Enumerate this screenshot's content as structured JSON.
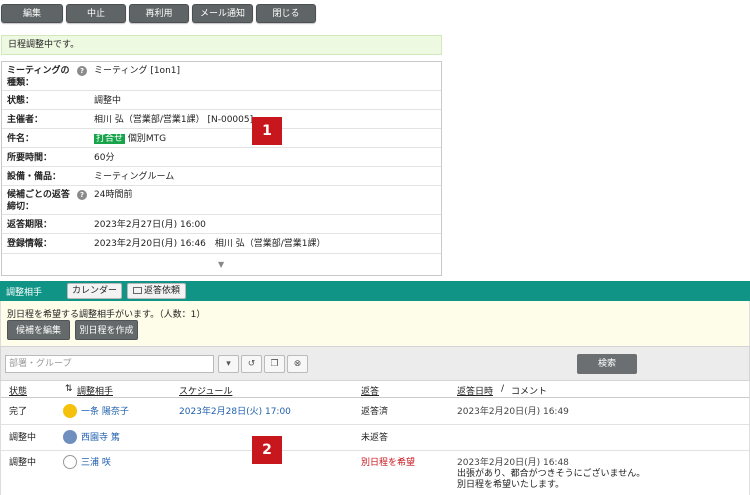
{
  "toolbar": {
    "buttons": [
      "編集",
      "中止",
      "再利用",
      "メール通知",
      "閉じる"
    ]
  },
  "notice": "日程調整中です。",
  "info": {
    "rows": [
      {
        "label": "ミーティングの種類：",
        "value": "ミーティング [1on1]",
        "help": true
      },
      {
        "label": "状態：",
        "value": "調整中"
      },
      {
        "label": "主催者：",
        "value": "相川 弘（営業部/営業1課） [N-00005]"
      },
      {
        "label": "件名：",
        "tag": "打合せ",
        "value": "個別MTG"
      },
      {
        "label": "所要時間：",
        "value": "60分"
      },
      {
        "label": "設備・備品：",
        "value": "ミーティングルーム"
      },
      {
        "label": "候補ごとの返答締切：",
        "value": "24時間前",
        "help": true
      },
      {
        "label": "返答期限：",
        "value": "2023年2月27日(月) 16:00"
      },
      {
        "label": "登録情報：",
        "value": "2023年2月20日(月) 16:46　相川 弘（営業部/営業1課）"
      }
    ]
  },
  "badges": [
    "1",
    "2"
  ],
  "participants_bar": {
    "title": "調整相手",
    "calendar_button": "カレンダー",
    "reply_request_button": "返答依頼"
  },
  "alert": {
    "message": "別日程を希望する調整相手がいます。（人数：1）",
    "edit_candidates_button": "候補を編集",
    "create_new_button": "別日程を作成"
  },
  "search": {
    "placeholder": "部署・グループ",
    "search_button": "検索"
  },
  "table": {
    "headers": {
      "status": "状態",
      "person": "調整相手",
      "schedule": "スケジュール",
      "reply": "返答",
      "reply_date": "返答日時",
      "comment_sep": "/",
      "comment": "コメント"
    },
    "rows": [
      {
        "status": "完了",
        "name": "一条 陽奈子",
        "schedule": "2023年2月28日(火) 17:00",
        "reply": "返答済",
        "reply_date": "2023年2月20日(月) 16:49",
        "comment": ""
      },
      {
        "status": "調整中",
        "name": "西園寺 篤",
        "schedule": "",
        "reply": "未返答",
        "reply_date": "",
        "comment": ""
      },
      {
        "status": "調整中",
        "name": "三浦 咲",
        "schedule": "",
        "reply": "別日程を希望",
        "reply_date": "2023年2月20日(月) 16:48",
        "comment": "出張があり、都合がつきそうにございません。",
        "comment2": "別日程を希望いたします。"
      }
    ]
  }
}
